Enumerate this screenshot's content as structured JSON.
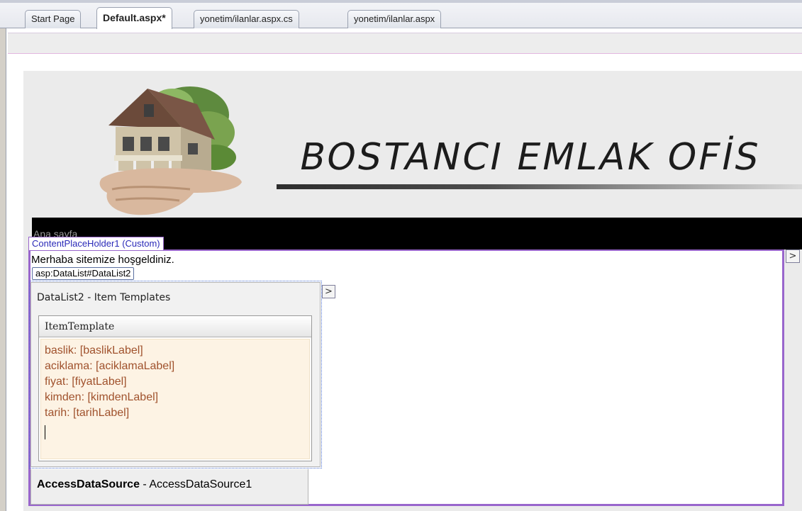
{
  "tabs": [
    {
      "label": "Start Page",
      "active": false
    },
    {
      "label": "Default.aspx*",
      "active": true
    },
    {
      "label": "yonetim/ilanlar.aspx.cs",
      "active": false
    },
    {
      "label": "yonetim/ilanlar.aspx",
      "active": false
    }
  ],
  "header": {
    "site_title": "BOSTANCI EMLAK OFİS",
    "logo_icon": "house-in-hand-icon"
  },
  "nav": {
    "home_link": "Ana sayfa"
  },
  "content_placeholder": {
    "tag": "ContentPlaceHolder1 (Custom)",
    "welcome_text": "Merhaba sitemize hoşgeldiniz.",
    "smart_tag_glyph": ">"
  },
  "datalist": {
    "tag": "asp:DataList#DataList2",
    "panel_title": "DataList2 - Item Templates",
    "smart_tag_glyph": ">",
    "template_name": "ItemTemplate",
    "template_lines": [
      "baslik: [baslikLabel]",
      "aciklama: [aciklamaLabel]",
      "fiyat: [fiyatLabel]",
      "kimden: [kimdenLabel]",
      "tarih: [tarihLabel]"
    ]
  },
  "datasource": {
    "type": "AccessDataSource",
    "separator": " - ",
    "id": "AccessDataSource1"
  },
  "colors": {
    "placeholder_border": "#9966cc",
    "template_text": "#a0522d",
    "template_bg": "#fdf3e4",
    "navbar_bg": "#000000"
  }
}
